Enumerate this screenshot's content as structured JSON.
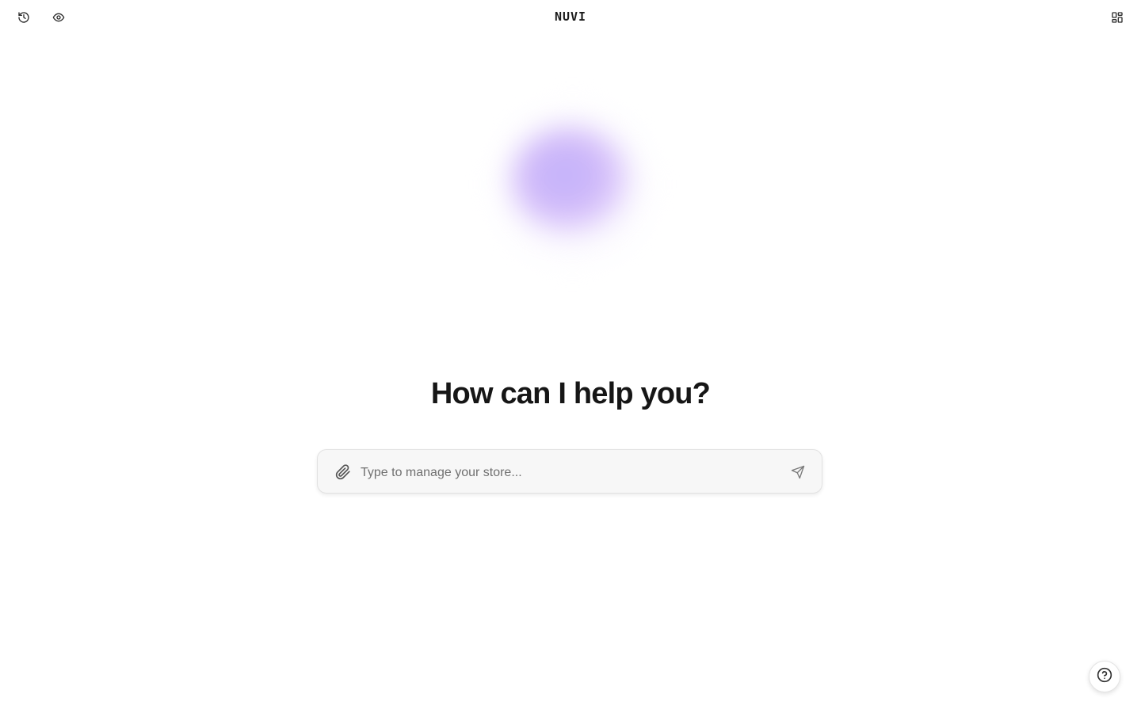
{
  "header": {
    "brand": "NUVI",
    "icons": {
      "history": "history-icon",
      "preview": "eye-icon",
      "layout": "layout-grid-icon"
    }
  },
  "main": {
    "headline": "How can I help you?",
    "orb_colors": [
      "#c3b3fb",
      "#dcc8fb"
    ]
  },
  "composer": {
    "placeholder": "Type to manage your store...",
    "value": "",
    "icons": {
      "attach": "paperclip-icon",
      "send": "send-icon"
    }
  },
  "help": {
    "icon": "help-circle-icon"
  }
}
